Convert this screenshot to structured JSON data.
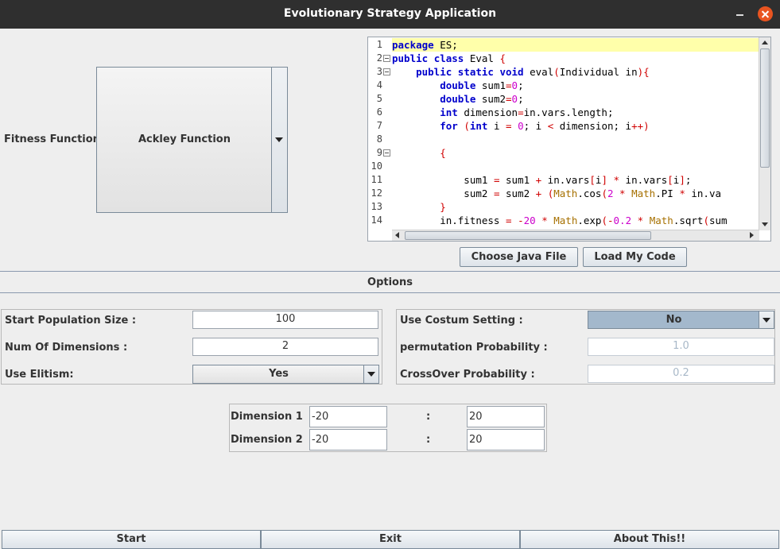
{
  "window": {
    "title": "Evolutionary Strategy Application"
  },
  "fitness": {
    "label": "Fitness Function:",
    "selected": "Ackley Function"
  },
  "editor": {
    "lines": [
      {
        "n": "1",
        "text": "package ES;"
      },
      {
        "n": "2",
        "text": "public class Eval {"
      },
      {
        "n": "3",
        "text": "    public static void eval(Individual in){"
      },
      {
        "n": "4",
        "text": "        double sum1=0;"
      },
      {
        "n": "5",
        "text": "        double sum2=0;"
      },
      {
        "n": "6",
        "text": "        int dimension=in.vars.length;"
      },
      {
        "n": "7",
        "text": "        for (int i = 0; i < dimension; i++)"
      },
      {
        "n": "8",
        "text": ""
      },
      {
        "n": "9",
        "text": "        {"
      },
      {
        "n": "10",
        "text": ""
      },
      {
        "n": "11",
        "text": "            sum1 = sum1 + in.vars[i] * in.vars[i];"
      },
      {
        "n": "12",
        "text": "            sum2 = sum2 + (Math.cos(2 * Math.PI * in.va"
      },
      {
        "n": "13",
        "text": "        }"
      },
      {
        "n": "14",
        "text": "        in.fitness = -20 * Math.exp(-0.2 * Math.sqrt(sum"
      }
    ]
  },
  "buttons": {
    "choose_java_file": "Choose Java File",
    "load_my_code": "Load My Code",
    "start": "Start",
    "exit": "Exit",
    "about": "About This!!"
  },
  "options": {
    "header": "Options",
    "start_population_label": "Start Population Size :",
    "start_population_value": "100",
    "num_dimensions_label": "Num Of Dimensions :",
    "num_dimensions_value": "2",
    "use_elitism_label": "Use Elitism:",
    "use_elitism_value": "Yes",
    "use_custom_label": "Use Costum Setting :",
    "use_custom_value": "No",
    "permutation_label": "permutation Probability :",
    "permutation_value": "1.0",
    "crossover_label": "CrossOver Probability :",
    "crossover_value": "0.2"
  },
  "dimensions": {
    "separator": ":",
    "rows": [
      {
        "label": "Dimension 1",
        "min": "-20",
        "max": "20"
      },
      {
        "label": "Dimension 2",
        "min": "-20",
        "max": "20"
      }
    ]
  }
}
